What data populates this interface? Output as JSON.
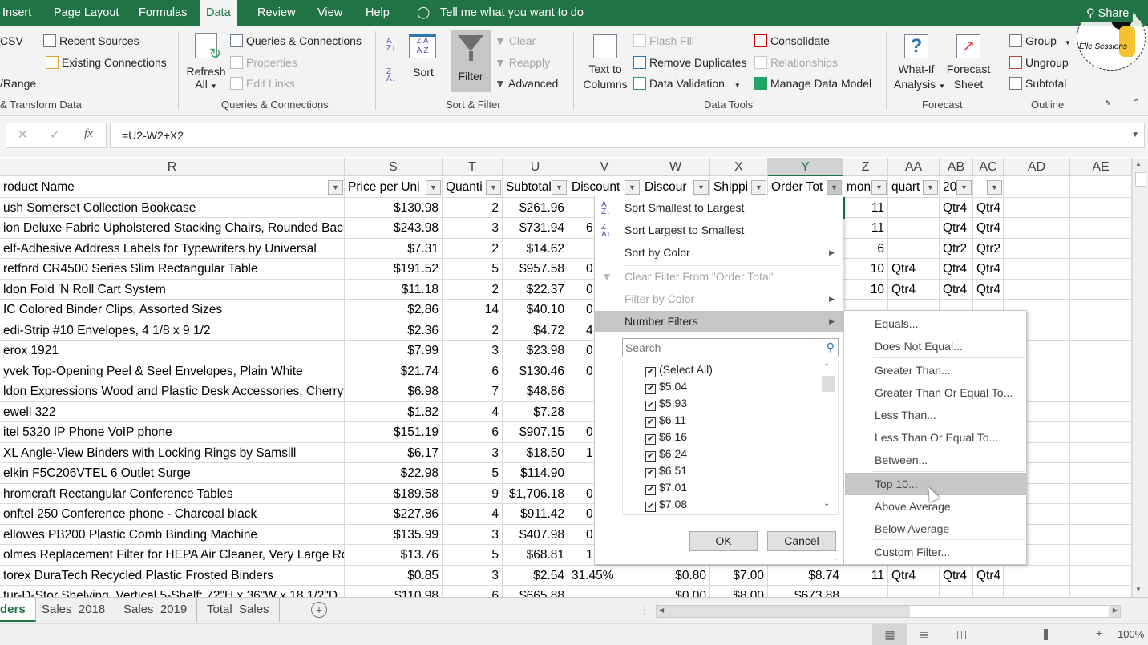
{
  "ribbon_tabs": [
    "Insert",
    "Page Layout",
    "Formulas",
    "Data",
    "Review",
    "View",
    "Help"
  ],
  "active_tab": "Data",
  "tell_me": "Tell me what you want to do",
  "share": "Share",
  "watermark": "Elle Sessions",
  "ribbon": {
    "get_data": {
      "csv": "CSV",
      "range": "/Range",
      "recent_sources": "Recent Sources",
      "existing_connections": "Existing Connections",
      "label": "& Transform Data"
    },
    "queries": {
      "refresh": "Refresh",
      "refresh_all": "All",
      "queries_connections": "Queries & Connections",
      "properties": "Properties",
      "edit_links": "Edit Links",
      "label": "Queries & Connections"
    },
    "sort_filter": {
      "sort": "Sort",
      "filter": "Filter",
      "clear": "Clear",
      "reapply": "Reapply",
      "advanced": "Advanced",
      "label": "Sort & Filter"
    },
    "data_tools": {
      "text_to": "Text to",
      "columns": "Columns",
      "flash_fill": "Flash Fill",
      "remove_duplicates": "Remove Duplicates",
      "data_validation": "Data Validation",
      "consolidate": "Consolidate",
      "relationships": "Relationships",
      "manage_data_model": "Manage Data Model",
      "label": "Data Tools"
    },
    "forecast": {
      "what_if": "What-If",
      "analysis": "Analysis",
      "forecast": "Forecast",
      "sheet": "Sheet",
      "label": "Forecast"
    },
    "outline": {
      "group": "Group",
      "ungroup": "Ungroup",
      "subtotal": "Subtotal",
      "label": "Outline"
    }
  },
  "formula_bar": {
    "cancel": "✕",
    "enter": "✓",
    "fx": "fx",
    "formula": "=U2-W2+X2"
  },
  "columns": [
    "R",
    "S",
    "T",
    "U",
    "V",
    "W",
    "X",
    "Y",
    "Z",
    "AA",
    "AB",
    "AC",
    "AD",
    "AE"
  ],
  "active_column": "Y",
  "headers": [
    "roduct Name",
    "Price per Uni",
    "Quanti",
    "Subtotal",
    "Discount",
    "Discour",
    "Shippi",
    "Order Tot",
    "mon",
    "quart",
    "20",
    ""
  ],
  "rows": [
    [
      "ush Somerset Collection Bookcase",
      "$130.98",
      "2",
      "$261.96",
      "",
      "",
      "",
      "",
      "11",
      "",
      "Qtr4",
      "Qtr4"
    ],
    [
      "ion Deluxe Fabric Upholstered Stacking Chairs, Rounded Back",
      "$243.98",
      "3",
      "$731.94",
      "6",
      "",
      "",
      "",
      "11",
      "",
      "Qtr4",
      "Qtr4"
    ],
    [
      "elf-Adhesive Address Labels for Typewriters by Universal",
      "$7.31",
      "2",
      "$14.62",
      "",
      "",
      "",
      "",
      "6",
      "",
      "Qtr2",
      "Qtr2"
    ],
    [
      "retford CR4500 Series Slim Rectangular Table",
      "$191.52",
      "5",
      "$957.58",
      "0",
      "",
      "",
      "",
      "10",
      "Qtr4",
      "Qtr4",
      "Qtr4"
    ],
    [
      "ldon Fold 'N Roll Cart System",
      "$11.18",
      "2",
      "$22.37",
      "0",
      "",
      "",
      "",
      "10",
      "Qtr4",
      "Qtr4",
      "Qtr4"
    ],
    [
      "IC Colored Binder Clips, Assorted Sizes",
      "$2.86",
      "14",
      "$40.10",
      "0",
      "",
      "",
      "",
      "",
      "",
      "",
      ""
    ],
    [
      "edi-Strip #10 Envelopes, 4 1/8 x 9 1/2",
      "$2.36",
      "2",
      "$4.72",
      "4",
      "",
      "",
      "",
      "",
      "",
      "",
      ""
    ],
    [
      "erox 1921",
      "$7.99",
      "3",
      "$23.98",
      "0",
      "",
      "",
      "",
      "",
      "",
      "",
      ""
    ],
    [
      "yvek  Top-Opening Peel & Seel Envelopes, Plain White",
      "$21.74",
      "6",
      "$130.46",
      "0",
      "",
      "",
      "",
      "",
      "",
      "",
      ""
    ],
    [
      "ldon Expressions Wood and Plastic Desk Accessories, Cherry",
      "$6.98",
      "7",
      "$48.86",
      "",
      "",
      "",
      "",
      "",
      "",
      "",
      ""
    ],
    [
      "ewell 322",
      "$1.82",
      "4",
      "$7.28",
      "",
      "",
      "",
      "",
      "",
      "",
      "",
      ""
    ],
    [
      "itel 5320 IP Phone VoIP phone",
      "$151.19",
      "6",
      "$907.15",
      "0",
      "",
      "",
      "",
      "",
      "",
      "",
      ""
    ],
    [
      "XL Angle-View Binders with Locking Rings by Samsill",
      "$6.17",
      "3",
      "$18.50",
      "1",
      "",
      "",
      "",
      "",
      "",
      "",
      ""
    ],
    [
      "elkin F5C206VTEL 6 Outlet Surge",
      "$22.98",
      "5",
      "$114.90",
      "",
      "",
      "",
      "",
      "",
      "",
      "",
      ""
    ],
    [
      "hromcraft Rectangular Conference Tables",
      "$189.58",
      "9",
      "$1,706.18",
      "0",
      "",
      "",
      "",
      "",
      "",
      "",
      ""
    ],
    [
      "onftel 250 Conference phone - Charcoal black",
      "$227.86",
      "4",
      "$911.42",
      "0",
      "",
      "",
      "",
      "",
      "",
      "",
      ""
    ],
    [
      "ellowes PB200 Plastic Comb Binding Machine",
      "$135.99",
      "3",
      "$407.98",
      "0",
      "",
      "",
      "",
      "",
      "",
      "",
      ""
    ],
    [
      "olmes Replacement Filter for HEPA Air Cleaner, Very Large Room",
      "$13.76",
      "5",
      "$68.81",
      "1",
      "",
      "",
      "",
      "",
      "",
      "",
      ""
    ],
    [
      "torex DuraTech Recycled Plastic Frosted Binders",
      "$0.85",
      "3",
      "$2.54",
      "31.45%",
      "$0.80",
      "$7.00",
      "$8.74",
      "11",
      "Qtr4",
      "Qtr4",
      "Qtr4"
    ],
    [
      "tur-D-Stor Shelving, Vertical 5-Shelf: 72\"H x 36\"W x 18 1/2\"D",
      "$110.98",
      "6",
      "$665.88",
      "",
      "$0.00",
      "$8.00",
      "$673.88",
      "",
      "",
      "",
      ""
    ]
  ],
  "filter_menu": {
    "sort_asc": "Sort Smallest to Largest",
    "sort_desc": "Sort Largest to Smallest",
    "sort_color": "Sort by Color",
    "clear_filter": "Clear Filter From \"Order Total\"",
    "filter_color": "Filter by Color",
    "number_filters": "Number Filters",
    "search_placeholder": "Search",
    "values": [
      "(Select All)",
      "$5.04",
      "$5.93",
      "$6.11",
      "$6.16",
      "$6.24",
      "$6.51",
      "$7.01",
      "$7.08"
    ],
    "ok": "OK",
    "cancel": "Cancel"
  },
  "number_filters_submenu": [
    "Equals...",
    "Does Not Equal...",
    "Greater Than...",
    "Greater Than Or Equal To...",
    "Less Than...",
    "Less Than Or Equal To...",
    "Between...",
    "Top 10...",
    "Above Average",
    "Below Average",
    "Custom Filter..."
  ],
  "highlighted_submenu_item": "Top 10...",
  "sheet_tabs": [
    "ders",
    "Sales_2018",
    "Sales_2019",
    "Total_Sales"
  ],
  "active_sheet": "ders",
  "status": {
    "zoom": "100%",
    "zoom_minus": "–",
    "zoom_plus": "+"
  },
  "colors": {
    "accent": "#217346",
    "ribbon_bg": "#f3f3f3",
    "highlight": "#c6c6c6"
  }
}
